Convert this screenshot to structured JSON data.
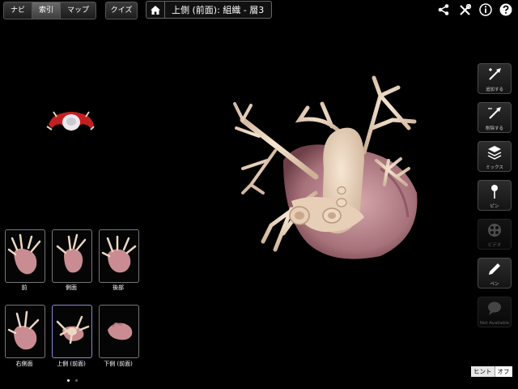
{
  "toolbar": {
    "tabs": [
      {
        "label": "ナビ",
        "selected": false
      },
      {
        "label": "索引",
        "selected": true
      },
      {
        "label": "マップ",
        "selected": false
      }
    ],
    "quiz_label": "クイズ"
  },
  "breadcrumb": {
    "title": "上側 (前面): 組織 - 層3"
  },
  "top_icons": [
    "share-icon",
    "tools-icon",
    "info-icon",
    "help-icon"
  ],
  "tools": [
    {
      "label": "追加する",
      "icon": "add-pin-icon"
    },
    {
      "label": "削除する",
      "icon": "remove-pin-icon"
    },
    {
      "label": "ミックス",
      "icon": "layers-icon"
    },
    {
      "label": "ピン",
      "icon": "pin-icon"
    },
    {
      "label": "ビデオ",
      "icon": "video-icon"
    },
    {
      "label": "ペン",
      "icon": "pen-icon"
    },
    {
      "label": "Not Available",
      "icon": "speech-bubble-icon"
    }
  ],
  "views": [
    {
      "label": "前"
    },
    {
      "label": "側面"
    },
    {
      "label": "後部"
    },
    {
      "label": "右側面"
    },
    {
      "label": "上側 (前面)"
    },
    {
      "label": "下側 (前面)"
    }
  ],
  "hint": {
    "label": "ヒント",
    "state": "オフ"
  },
  "colors": {
    "background": "#000000",
    "selected_border": "#8a8ad8",
    "vessel": "#e8d2bb",
    "myocardium": "#b8868c"
  }
}
